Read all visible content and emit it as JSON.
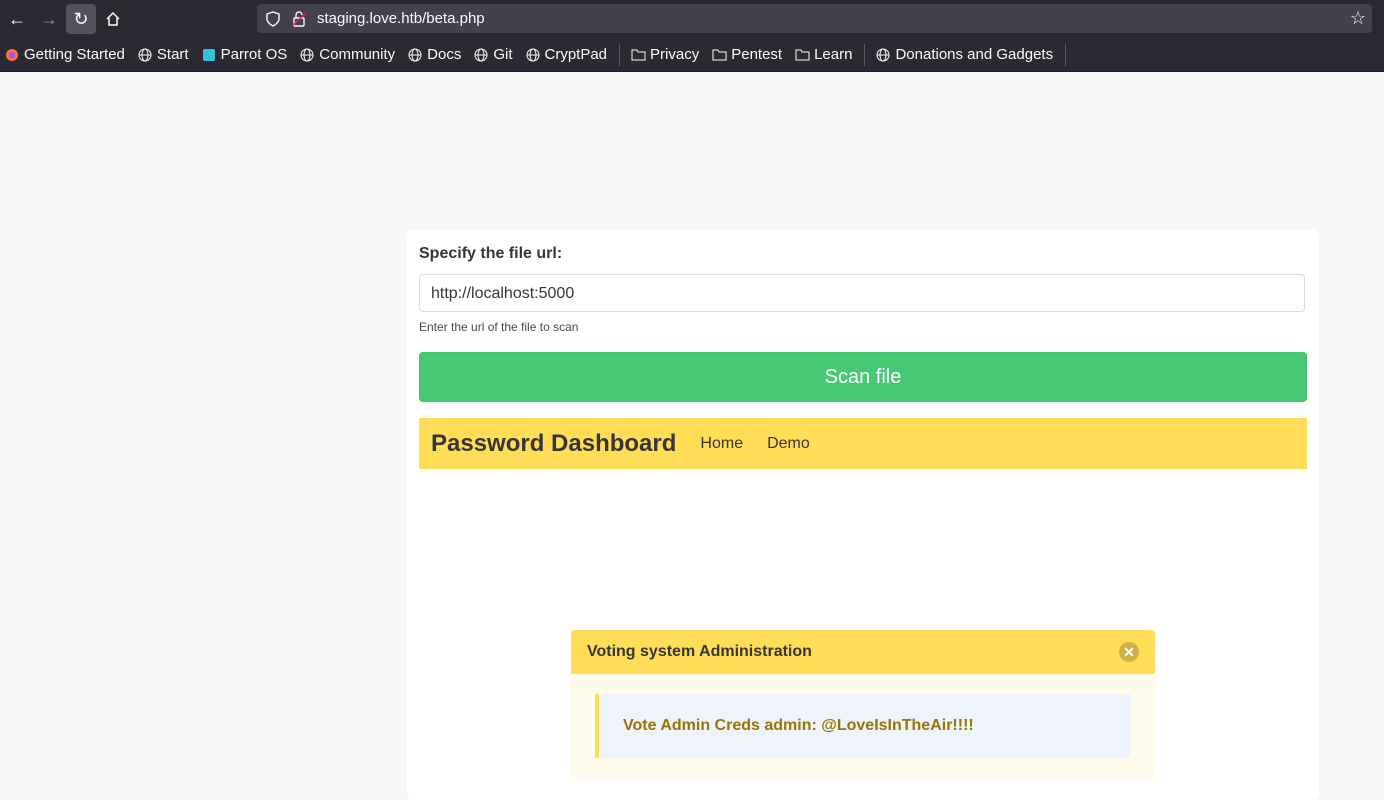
{
  "browser": {
    "url": "staging.love.htb/beta.php",
    "bookmarks": [
      {
        "label": "Getting Started",
        "icon": "firefox-icon"
      },
      {
        "label": "Start",
        "icon": "globe-icon"
      },
      {
        "label": "Parrot OS",
        "icon": "parrot-icon"
      },
      {
        "label": "Community",
        "icon": "globe-icon"
      },
      {
        "label": "Docs",
        "icon": "globe-icon"
      },
      {
        "label": "Git",
        "icon": "globe-icon"
      },
      {
        "label": "CryptPad",
        "icon": "globe-icon"
      },
      {
        "label": "Privacy",
        "icon": "folder-icon"
      },
      {
        "label": "Pentest",
        "icon": "folder-icon"
      },
      {
        "label": "Learn",
        "icon": "folder-icon"
      },
      {
        "label": "Donations and Gadgets",
        "icon": "globe-icon"
      }
    ]
  },
  "form": {
    "label": "Specify the file url:",
    "input_value": "http://localhost:5000",
    "help": "Enter the url of the file to scan",
    "scan_button": "Scan file"
  },
  "dashboard": {
    "brand": "Password Dashboard",
    "nav": [
      "Home",
      "Demo"
    ]
  },
  "message": {
    "title": "Voting system Administration",
    "body": "Vote Admin Creds admin: @LoveIsInTheAir!!!!"
  },
  "colors": {
    "success": "#48c774",
    "warning": "#ffdd57",
    "warning_text": "#947600"
  }
}
